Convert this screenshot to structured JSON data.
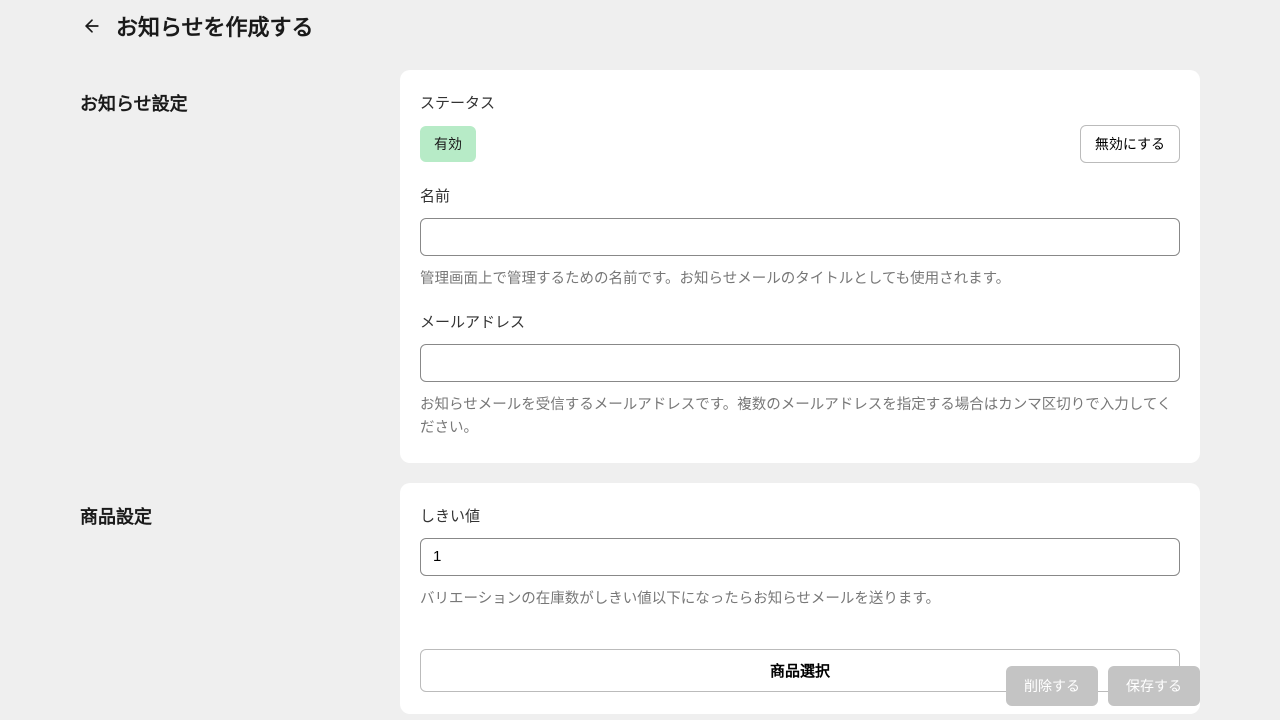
{
  "header": {
    "title": "お知らせを作成する"
  },
  "sections": {
    "notification": {
      "title": "お知らせ設定",
      "status": {
        "label": "ステータス",
        "badge": "有効",
        "disable_button": "無効にする"
      },
      "name": {
        "label": "名前",
        "value": "",
        "help": "管理画面上で管理するための名前です。お知らせメールのタイトルとしても使用されます。"
      },
      "email": {
        "label": "メールアドレス",
        "value": "",
        "help": "お知らせメールを受信するメールアドレスです。複数のメールアドレスを指定する場合はカンマ区切りで入力してください。"
      }
    },
    "product": {
      "title": "商品設定",
      "threshold": {
        "label": "しきい値",
        "value": "1",
        "help": "バリエーションの在庫数がしきい値以下になったらお知らせメールを送ります。"
      },
      "select_button": "商品選択"
    }
  },
  "footer": {
    "delete": "削除する",
    "save": "保存する"
  }
}
